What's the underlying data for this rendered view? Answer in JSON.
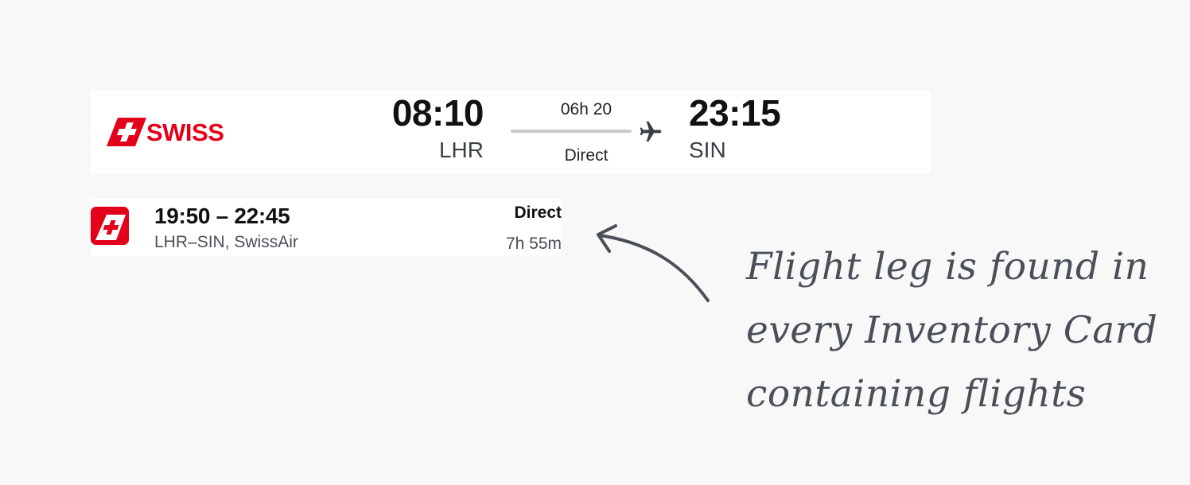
{
  "flight_card": {
    "airline_logo_text": "SWISS",
    "departure": {
      "time": "08:10",
      "airport": "LHR"
    },
    "duration": "06h 20",
    "stops": "Direct",
    "arrival": {
      "time": "23:15",
      "airport": "SIN"
    },
    "icons": {
      "logo": "swiss-tail-icon",
      "plane": "plane-icon"
    }
  },
  "flight_leg": {
    "times": "19:50 – 22:45",
    "route": "LHR–SIN, SwissAir",
    "stops": "Direct",
    "duration": "7h 55m",
    "icon": "swiss-logo-icon"
  },
  "annotation": {
    "lines": [
      "Flight leg is found in",
      "every Inventory Card",
      "containing flights"
    ]
  },
  "colors": {
    "brand_red": "#e2001a",
    "background": "#f8f8f8",
    "annotation_gray": "#4b5058"
  }
}
